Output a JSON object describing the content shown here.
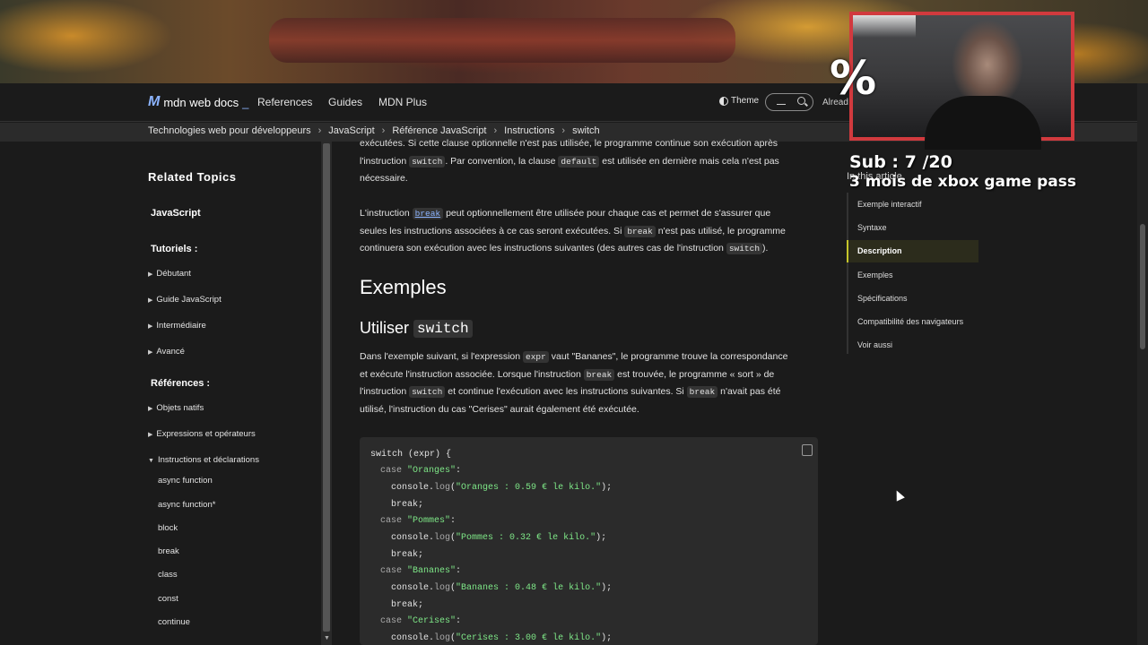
{
  "nav": {
    "logo_text": "mdn web docs",
    "links": [
      "References",
      "Guides",
      "MDN Plus"
    ],
    "theme_label": "Theme",
    "already_label": "Alread"
  },
  "breadcrumb": [
    "Technologies web pour développeurs",
    "JavaScript",
    "Référence JavaScript",
    "Instructions",
    "switch"
  ],
  "sidebar": {
    "title": "Related Topics",
    "javascript": "JavaScript",
    "tutoriels": "Tutoriels :",
    "tutoriels_items": [
      "Débutant",
      "Guide JavaScript",
      "Intermédiaire",
      "Avancé"
    ],
    "references": "Références :",
    "references_items": [
      "Objets natifs",
      "Expressions et opérateurs",
      "Instructions et déclarations"
    ],
    "sub_items": [
      "async function",
      "async function*",
      "block",
      "break",
      "class",
      "const",
      "continue"
    ]
  },
  "content": {
    "para1_a": "exécutées. Si cette clause optionnelle n'est pas utilisée, le programme continue son exécution après",
    "para1_b1": "l'instruction",
    "para1_code1": "switch",
    "para1_b2": ". Par convention, la clause",
    "para1_code2": "default",
    "para1_b3": "est utilisée en dernière mais cela n'est pas",
    "para1_c": "nécessaire.",
    "para2_a1": "L'instruction",
    "para2_code1": "break",
    "para2_a2": "peut optionnellement être utilisée pour chaque cas et permet de s'assurer que",
    "para2_b1": "seules les instructions associées à ce cas seront exécutées. Si",
    "para2_code2": "break",
    "para2_b2": "n'est pas utilisé, le programme",
    "para2_c1": "continuera son exécution avec les instructions suivantes (des autres cas de l'instruction",
    "para2_code3": "switch",
    "para2_c2": ").",
    "h2": "Exemples",
    "h3_text": "Utiliser",
    "h3_code": "switch",
    "para3_a1": "Dans l'exemple suivant, si l'expression",
    "para3_code1": "expr",
    "para3_a2": "vaut \"Bananes\", le programme trouve la correspondance",
    "para3_b1": "et exécute l'instruction associée. Lorsque l'instruction",
    "para3_code2": "break",
    "para3_b2": "est trouvée, le programme « sort » de",
    "para3_c1": "l'instruction",
    "para3_code3": "switch",
    "para3_c2": "et continue l'exécution avec les instructions suivantes. Si",
    "para3_code4": "break",
    "para3_c3": "n'avait pas été",
    "para3_d": "utilisé, l'instruction du cas \"Cerises\" aurait également été exécutée."
  },
  "code": {
    "line1_kw": "switch",
    "line1_rest": " (expr) {",
    "cases": [
      {
        "case_kw": "case",
        "label": "\"Oranges\"",
        "log_str": "\"Oranges : 0.59 € le kilo.\""
      },
      {
        "case_kw": "case",
        "label": "\"Pommes\"",
        "log_str": "\"Pommes : 0.32 € le kilo.\""
      },
      {
        "case_kw": "case",
        "label": "\"Bananes\"",
        "log_str": "\"Bananes : 0.48 € le kilo.\""
      },
      {
        "case_kw": "case",
        "label": "\"Cerises\"",
        "log_str": "\"Cerises : 3.00 € le kilo.\""
      }
    ],
    "console_prefix": "console.",
    "log_fn": "log",
    "break_stmt": "break;"
  },
  "toc": {
    "heading": "In this article",
    "items": [
      "Exemple interactif",
      "Syntaxe",
      "Description",
      "Exemples",
      "Spécifications",
      "Compatibilité des navigateurs",
      "Voir aussi"
    ],
    "active_index": 2
  },
  "overlay": {
    "percent": "%",
    "sub_text": "Sub :  7  /20",
    "promo_text": "3  mois de xbox game pass"
  }
}
